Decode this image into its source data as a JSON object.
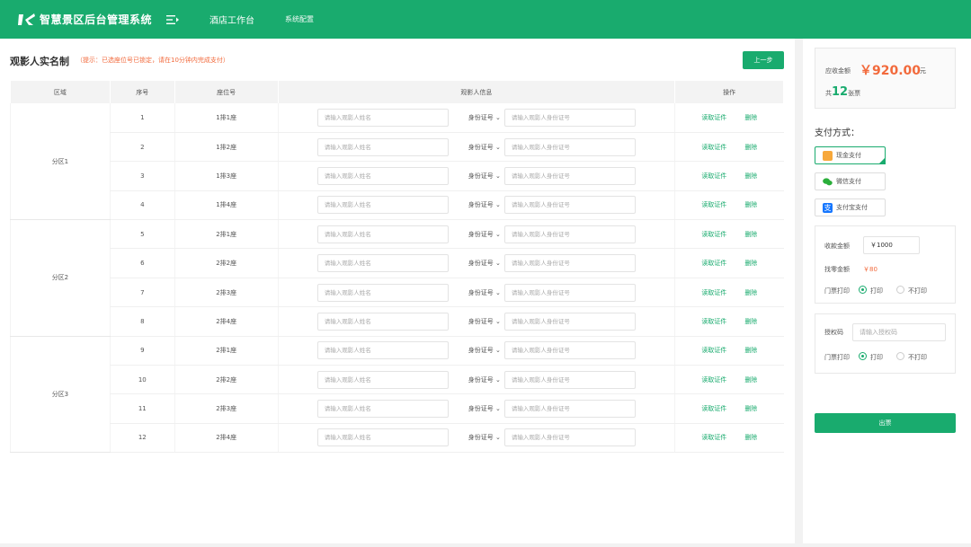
{
  "header": {
    "app_title": "智慧景区后台管理系统",
    "nav": [
      "酒店工作台",
      "系统配置"
    ]
  },
  "page": {
    "title": "观影人实名制",
    "hint": "（提示：已选座位号已锁定，请在10分钟内完成支付）",
    "prev_button": "上一步"
  },
  "table": {
    "headers": [
      "区域",
      "序号",
      "座位号",
      "观影人信息",
      "操作"
    ],
    "name_placeholder": "请输入观影人姓名",
    "id_type": "身份证号",
    "id_placeholder": "请输入观影人身份证号",
    "op_read": "读取证件",
    "op_delete": "删除",
    "zones": [
      {
        "name": "分区1",
        "rows": [
          {
            "no": "1",
            "seat": "1排1座"
          },
          {
            "no": "2",
            "seat": "1排2座"
          },
          {
            "no": "3",
            "seat": "1排3座"
          },
          {
            "no": "4",
            "seat": "1排4座"
          }
        ]
      },
      {
        "name": "分区2",
        "rows": [
          {
            "no": "5",
            "seat": "2排1座"
          },
          {
            "no": "6",
            "seat": "2排2座"
          },
          {
            "no": "7",
            "seat": "2排3座"
          },
          {
            "no": "8",
            "seat": "2排4座"
          }
        ]
      },
      {
        "name": "分区3",
        "rows": [
          {
            "no": "9",
            "seat": "2排1座"
          },
          {
            "no": "10",
            "seat": "2排2座"
          },
          {
            "no": "11",
            "seat": "2排3座"
          },
          {
            "no": "12",
            "seat": "2排4座"
          }
        ]
      }
    ]
  },
  "summary": {
    "due_label": "应收金额",
    "due_amount": "￥920.00",
    "due_unit": "元",
    "count_prefix": "共",
    "count": "12",
    "count_suffix": "张票"
  },
  "payment": {
    "title": "支付方式：",
    "methods": [
      "现金支付",
      "微信支付",
      "支付宝支付"
    ],
    "selected": "现金支付"
  },
  "cash": {
    "received_label": "收款金额",
    "received_value": "￥1000",
    "change_label": "找零金额",
    "change_value": "￥80",
    "print_label": "门票打印",
    "print_option": "打印",
    "noprint_option": "不打印"
  },
  "auth": {
    "label": "授权码",
    "placeholder": "请输入授权码",
    "print_label": "门票打印",
    "print_option": "打印",
    "noprint_option": "不打印"
  },
  "submit_label": "出票",
  "colors": {
    "brand": "#19ab6e",
    "accent": "#f26a3c"
  }
}
